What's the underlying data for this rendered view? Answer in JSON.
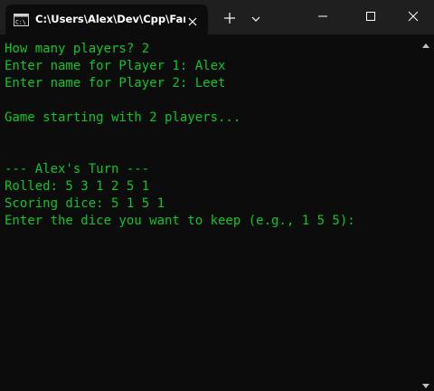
{
  "window": {
    "tab_title": "C:\\Users\\Alex\\Dev\\Cpp\\Far",
    "tab_icon": "cmd-terminal-icon",
    "colors": {
      "titlebar": "#1f1f1f",
      "background": "#0c0c0c",
      "text": "#13c42a"
    }
  },
  "terminal": {
    "lines": [
      "How many players? 2",
      "Enter name for Player 1: Alex",
      "Enter name for Player 2: Leet",
      "",
      "Game starting with 2 players...",
      "",
      "",
      "--- Alex's Turn ---",
      "Rolled: 5 3 1 2 5 1",
      "Scoring dice: 5 1 5 1",
      "Enter the dice you want to keep (e.g., 1 5 5):"
    ]
  }
}
